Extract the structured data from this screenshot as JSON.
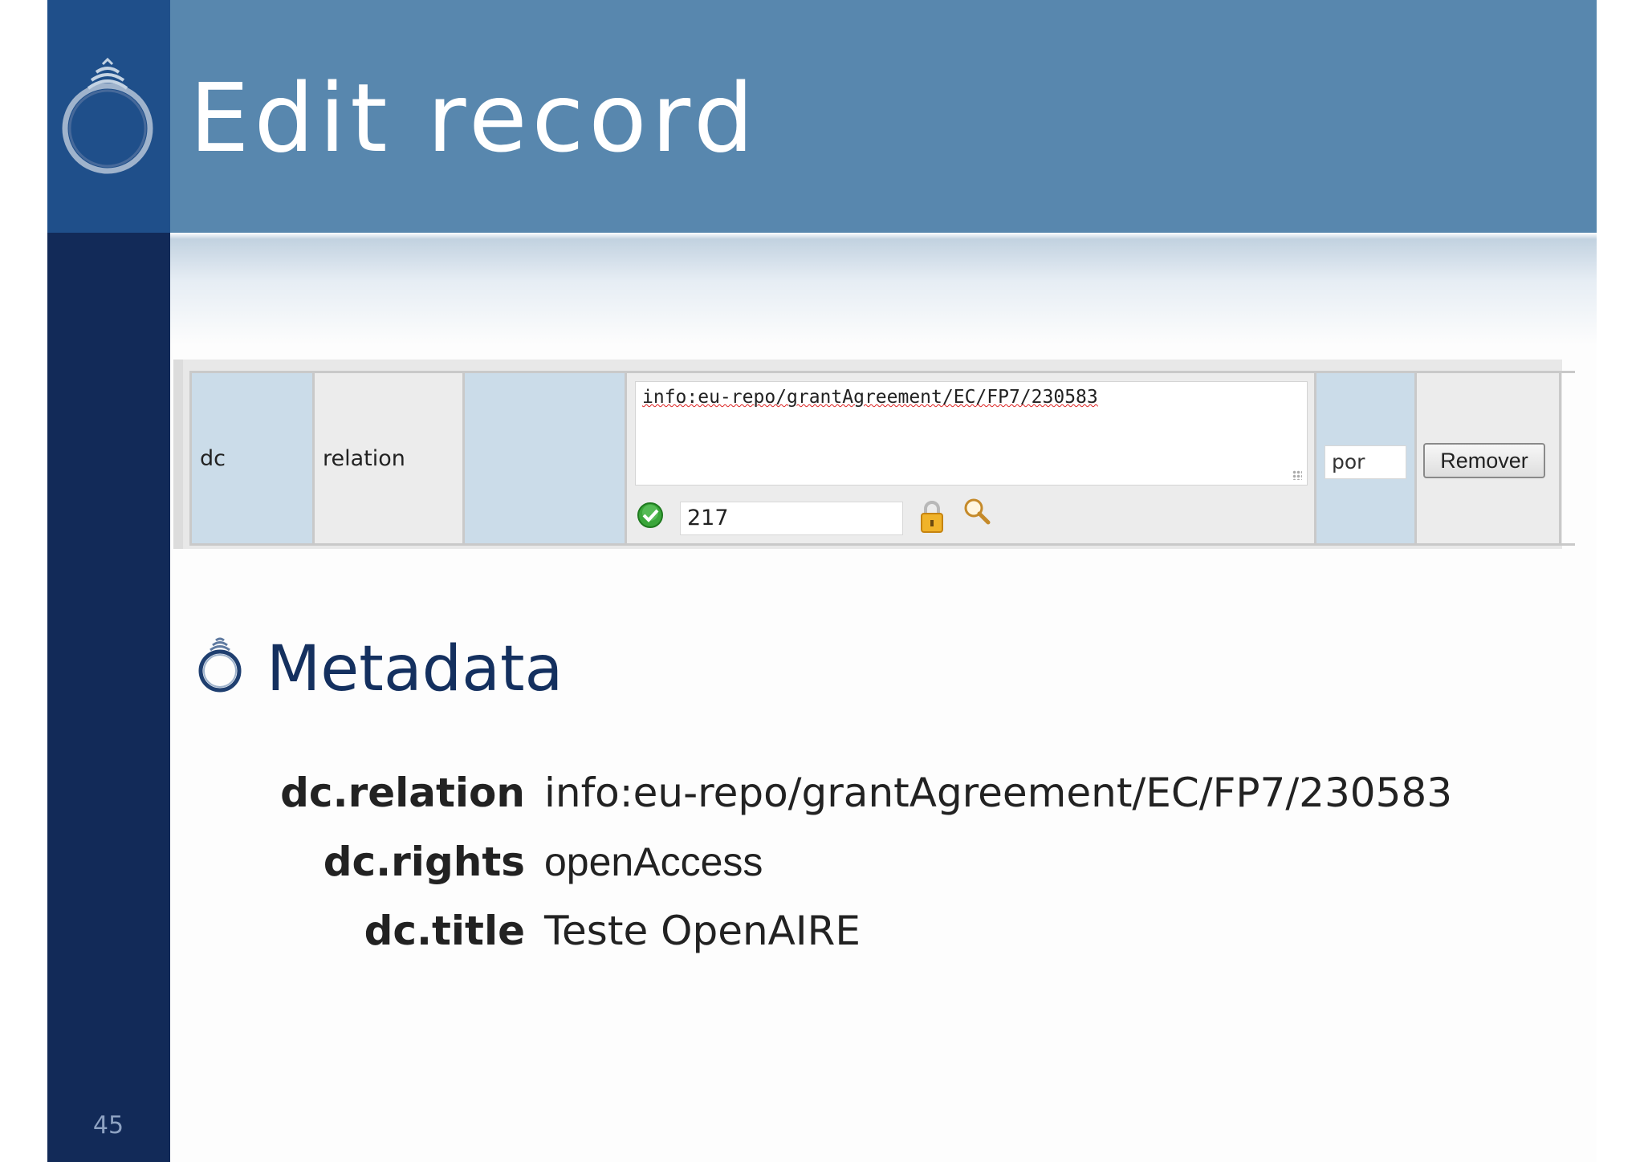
{
  "slide": {
    "title": "Edit record",
    "number": "45"
  },
  "record_panel": {
    "schema": "dc",
    "element": "relation",
    "qualifier": "",
    "value": "info:eu-repo/grantAgreement/EC/FP7/230583",
    "authority_id": "217",
    "language": "por",
    "remove_label": "Remover"
  },
  "bullet": {
    "heading": "Metadata"
  },
  "metadata": [
    {
      "key": "dc.relation",
      "value": "info:eu-repo/grantAgreement/EC/FP7/230583"
    },
    {
      "key": "dc.rights",
      "value": "openAccess"
    },
    {
      "key": "dc.title",
      "value": "Teste OpenAIRE"
    }
  ],
  "colors": {
    "header": "#5887ae",
    "sidebar": "#122a58",
    "logo_box": "#1f4f8a",
    "heading_text": "#14305f",
    "cell_blue": "#cbdce9"
  },
  "icons": {
    "logo": "ring-logo-icon",
    "status": "check-circle-icon",
    "lock": "lock-icon",
    "lookup": "magnifier-icon"
  }
}
